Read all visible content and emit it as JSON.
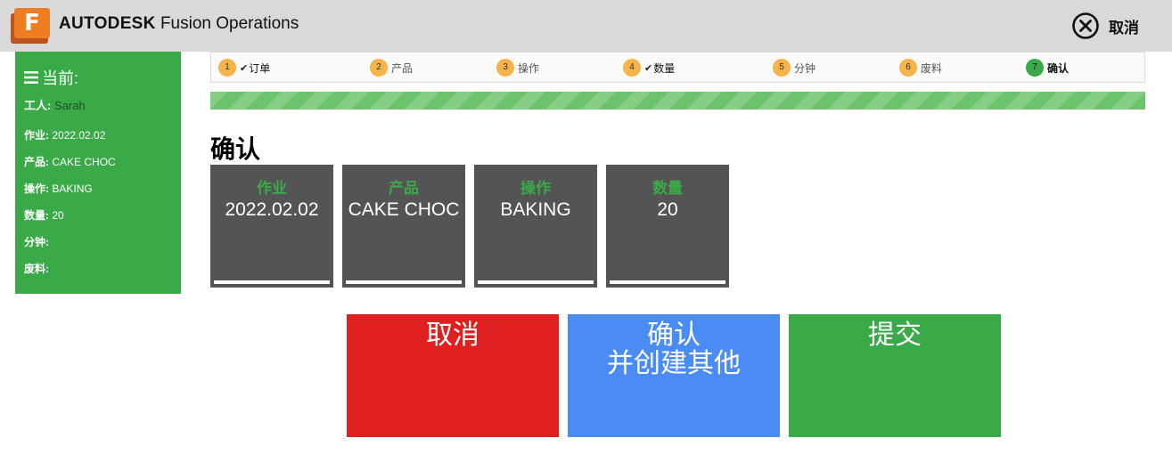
{
  "header": {
    "brand_bold": "AUTODESK",
    "brand_rest": " Fusion Operations",
    "logo_letter": "F",
    "cancel_label": "取消",
    "colors": {
      "bar": "#d9d9d9",
      "logo_front": "#ef7d22",
      "logo_back": "#c0521f"
    }
  },
  "sidebar": {
    "title": "当前:",
    "icon": "menu-icon",
    "worker_label": "工人:",
    "worker_value": "Sarah",
    "rows": [
      {
        "label": "作业:",
        "value": "2022.02.02"
      },
      {
        "label": "产品:",
        "value": "CAKE CHOC"
      },
      {
        "label": "操作:",
        "value": "BAKING"
      },
      {
        "label": "数量:",
        "value": "20"
      },
      {
        "label": "分钟:",
        "value": ""
      },
      {
        "label": "废料:",
        "value": ""
      }
    ],
    "color": "#39aa47"
  },
  "steps": [
    {
      "num": "1",
      "label": "订单",
      "status": "done"
    },
    {
      "num": "2",
      "label": "产品",
      "status": "pending"
    },
    {
      "num": "3",
      "label": "操作",
      "status": "pending"
    },
    {
      "num": "4",
      "label": "数量",
      "status": "done"
    },
    {
      "num": "5",
      "label": "分钟",
      "status": "pending"
    },
    {
      "num": "6",
      "label": "废料",
      "status": "pending"
    },
    {
      "num": "7",
      "label": "确认",
      "status": "active"
    }
  ],
  "progress": {
    "percent": 100
  },
  "heading": "确认",
  "cards": [
    {
      "title": "作业",
      "value": "2022.02.02"
    },
    {
      "title": "产品",
      "value": "CAKE CHOC"
    },
    {
      "title": "操作",
      "value": "BAKING"
    },
    {
      "title": "数量",
      "value": "20"
    }
  ],
  "actions": {
    "cancel": "取消",
    "confirm_line1": "确认",
    "confirm_line2": "并创建其他",
    "submit": "提交",
    "colors": {
      "cancel": "#e02020",
      "confirm": "#4a8cf3",
      "submit": "#39aa47"
    }
  }
}
